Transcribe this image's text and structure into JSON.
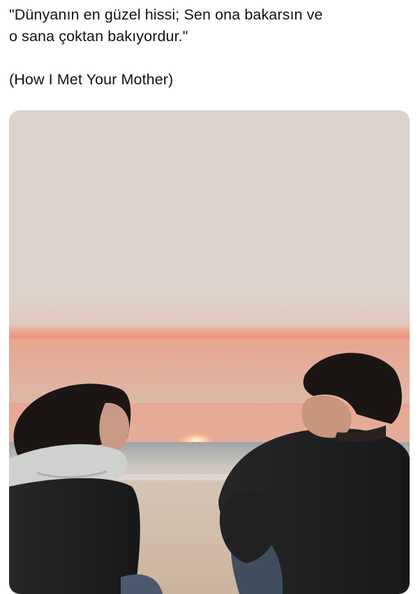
{
  "tweet": {
    "quote_line_1": "\"Dünyanın en güzel hissi; Sen ona bakarsın ve",
    "quote_line_2": "o sana çoktan bakıyordur.\"",
    "source": "(How I Met Your Mother)"
  },
  "media": {
    "description_icon": "photo-couple-beach-sunset",
    "colors": {
      "sky": "#dcd3ce",
      "sunset_glow": "#f08f72",
      "sea": "#b9b8b6",
      "sand": "#d9c7b6",
      "sweater": "#1f1f22",
      "hood": "#cfd1d0",
      "hair": "#1a1514"
    }
  }
}
